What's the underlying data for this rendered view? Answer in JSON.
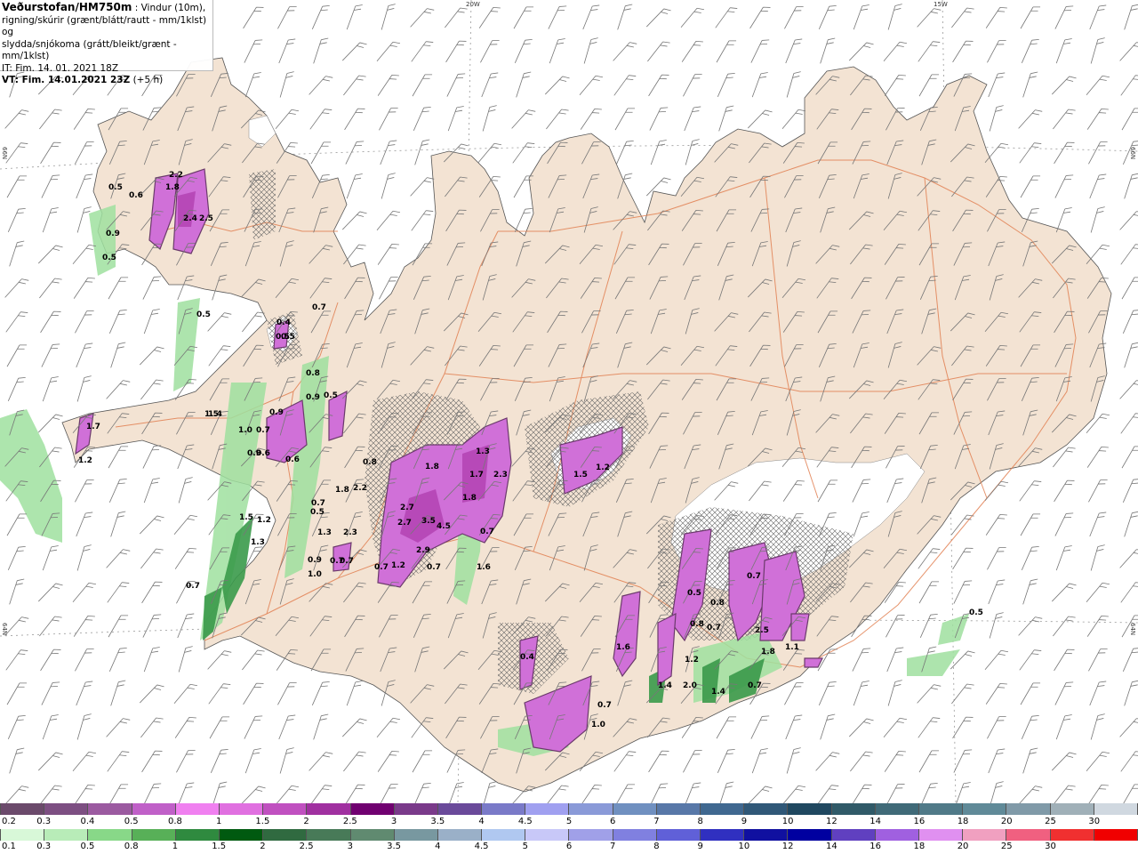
{
  "header": {
    "title": "Veðurstofan/HM750m",
    "title_suffix": " : Vindur (10m),",
    "line2": "rigning/skúrir (grænt/blátt/rautt - mm/1klst) og",
    "line3": "slydda/snjókoma (grátt/bleikt/grænt - mm/1klst)",
    "it": "IT: Fim. 14. 01. 2021 18Z",
    "vt_prefix": "VT: Fim. 14.01.2021 23Z",
    "vt_suffix": " (+5 h)"
  },
  "grid_labels": {
    "lon_20w": "20W",
    "lon_15w": "15W",
    "lat_66n_left": "66N",
    "lat_66n_right": "66N",
    "lat_64n_left": "64N",
    "lat_64n_right": "64N"
  },
  "colors": {
    "land": "#f3e3d3",
    "roads": "#e07a4a",
    "snow_purple": "#d050d0",
    "rain_green": "#5fb86a",
    "sea": "#ffffff"
  },
  "snow_scale": {
    "labels": [
      "0.2",
      "0.3",
      "0.4",
      "0.5",
      "0.8",
      "1",
      "1.5",
      "2",
      "2.5",
      "3",
      "3.5",
      "4",
      "4.5",
      "5",
      "6",
      "7",
      "8",
      "9",
      "10",
      "12",
      "14",
      "16",
      "18",
      "20",
      "25",
      "30"
    ],
    "colors": [
      "#6b4a6b",
      "#7d4f82",
      "#9b5aa0",
      "#c060c8",
      "#f080f0",
      "#e070e0",
      "#c050c0",
      "#a030a0",
      "#700070",
      "#7a3a8a",
      "#6a4a9a",
      "#7a7ac8",
      "#a0a0f0",
      "#8a9ad8",
      "#7090c0",
      "#5878a8",
      "#406890",
      "#305878",
      "#204860",
      "#305a68",
      "#406a78",
      "#507a88",
      "#608a98",
      "#809aa8",
      "#a0b0b8",
      "#d0d8e0"
    ]
  },
  "rain_scale": {
    "labels": [
      "0.1",
      "0.3",
      "0.5",
      "0.8",
      "1",
      "1.5",
      "2",
      "2.5",
      "3",
      "3.5",
      "4",
      "4.5",
      "5",
      "6",
      "7",
      "8",
      "9",
      "10",
      "12",
      "14",
      "16",
      "18",
      "20",
      "25",
      "30"
    ],
    "colors": [
      "#d8f8d8",
      "#b8ecb8",
      "#88d888",
      "#58b058",
      "#2f8a3f",
      "#005a10",
      "#306a40",
      "#487a58",
      "#608a70",
      "#7898a0",
      "#9ab0c8",
      "#b0c8f0",
      "#c8c8f8",
      "#a0a0e8",
      "#8080e0",
      "#6060d8",
      "#3030c0",
      "#1010a0",
      "#0000a0",
      "#6040c0",
      "#a060e0",
      "#e090f0",
      "#f0a0c0",
      "#f06080",
      "#f03030",
      "#f00000"
    ]
  },
  "precip_labels": [
    {
      "text": "0.5"
    },
    {
      "text": "0.6"
    },
    {
      "text": "1.8"
    },
    {
      "text": "2.2"
    },
    {
      "text": "2.4"
    },
    {
      "text": "2.5"
    },
    {
      "text": "0.9"
    },
    {
      "text": "0.5"
    },
    {
      "text": "0.5"
    },
    {
      "text": "0.7"
    },
    {
      "text": "0.5"
    },
    {
      "text": "1.5"
    },
    {
      "text": "1.7"
    },
    {
      "text": "1.2"
    },
    {
      "text": "1.4"
    },
    {
      "text": "1.0"
    },
    {
      "text": "0.7"
    },
    {
      "text": "0.9"
    },
    {
      "text": "0.6"
    },
    {
      "text": "0.9"
    },
    {
      "text": "0.6"
    },
    {
      "text": "0.5"
    },
    {
      "text": "0.9"
    },
    {
      "text": "0.8"
    },
    {
      "text": "1.5"
    },
    {
      "text": "1.2"
    },
    {
      "text": "1.3"
    },
    {
      "text": "1.8"
    },
    {
      "text": "2.2"
    },
    {
      "text": "0.7"
    },
    {
      "text": "0.5"
    },
    {
      "text": "1.8"
    },
    {
      "text": "2.7"
    },
    {
      "text": "3.5"
    },
    {
      "text": "4.5"
    },
    {
      "text": "2.7"
    },
    {
      "text": "2.9"
    },
    {
      "text": "1.2"
    },
    {
      "text": "0.7"
    },
    {
      "text": "1.7"
    },
    {
      "text": "1.3"
    },
    {
      "text": "2.3"
    },
    {
      "text": "1.8"
    },
    {
      "text": "0.7"
    },
    {
      "text": "1.6"
    },
    {
      "text": "1.5"
    },
    {
      "text": "1.2"
    },
    {
      "text": "0.8"
    },
    {
      "text": "1.3"
    },
    {
      "text": "0.7"
    },
    {
      "text": "0.7"
    },
    {
      "text": "1.0"
    },
    {
      "text": "0.9"
    },
    {
      "text": "0.7"
    },
    {
      "text": "2.3"
    },
    {
      "text": "0.7"
    },
    {
      "text": "0.5"
    },
    {
      "text": "0.4"
    },
    {
      "text": "1.6"
    },
    {
      "text": "0.7"
    },
    {
      "text": "1.0"
    },
    {
      "text": "2.0"
    },
    {
      "text": "1.4"
    },
    {
      "text": "1.2"
    },
    {
      "text": "0.8"
    },
    {
      "text": "0.5"
    },
    {
      "text": "0.4"
    },
    {
      "text": "0.7"
    },
    {
      "text": "2.5"
    },
    {
      "text": "1.8"
    },
    {
      "text": "1.1"
    },
    {
      "text": "0.7"
    },
    {
      "text": "1.4"
    },
    {
      "text": "0.5"
    },
    {
      "text": "0.8"
    },
    {
      "text": "0.7"
    }
  ]
}
